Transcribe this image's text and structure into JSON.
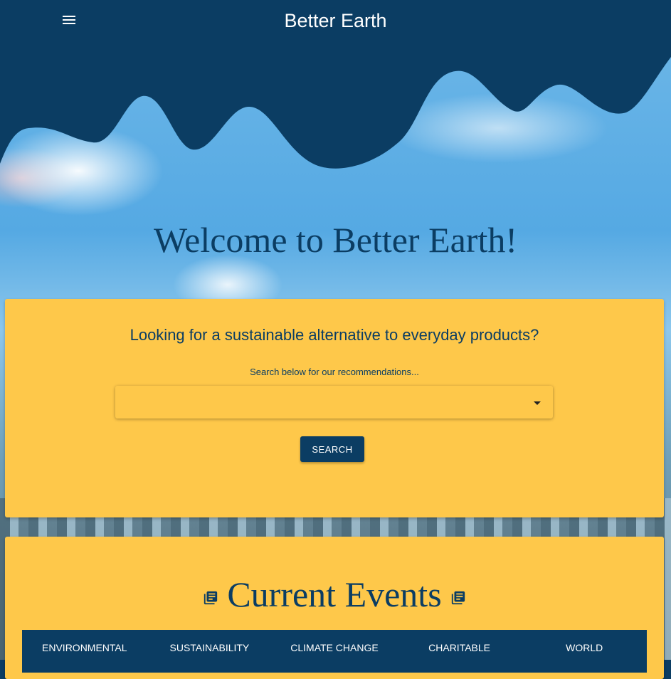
{
  "app": {
    "title": "Better Earth"
  },
  "hero": {
    "welcome": "Welcome to Better Earth!"
  },
  "search": {
    "heading": "Looking for a sustainable alternative to everyday products?",
    "hint": "Search below for our recommendations...",
    "selected_value": "",
    "button_label": "SEARCH"
  },
  "events": {
    "title": "Current Events",
    "tabs": [
      {
        "label": "ENVIRONMENTAL"
      },
      {
        "label": "SUSTAINABILITY"
      },
      {
        "label": "CLIMATE CHANGE"
      },
      {
        "label": "CHARITABLE"
      },
      {
        "label": "WORLD"
      }
    ]
  },
  "colors": {
    "navy": "#0b3d63",
    "accent_yellow": "#fec84a"
  },
  "icons": {
    "menu": "menu-icon",
    "caret": "caret-down-icon",
    "news": "newspaper-icon"
  }
}
